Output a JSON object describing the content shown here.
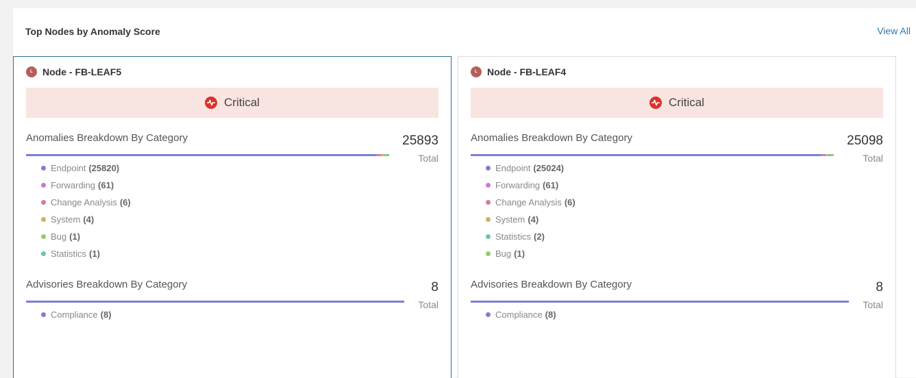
{
  "panel": {
    "title": "Top Nodes by Anomaly Score",
    "view_all": "View All"
  },
  "colors": {
    "endpoint": "#7b7fd4",
    "forwarding": "#c77ad4",
    "change_analysis": "#d67c96",
    "system": "#d0b060",
    "bug": "#8ccf6a",
    "statistics": "#6cc7a8",
    "compliance": "#7b7fd4",
    "critical": "#d9342b",
    "critical_bg": "#f8e4e0",
    "node_badge": "#b65f5a"
  },
  "cards": [
    {
      "node_badge": "L",
      "node_title": "Node -  FB-LEAF5",
      "severity": "Critical",
      "anomalies": {
        "title": "Anomalies Breakdown By Category",
        "total": "25893",
        "total_label": "Total",
        "items": [
          {
            "label": "Endpoint",
            "count": "(25820)",
            "color_key": "endpoint",
            "value": 25820
          },
          {
            "label": "Forwarding",
            "count": "(61)",
            "color_key": "forwarding",
            "value": 61
          },
          {
            "label": "Change Analysis",
            "count": "(6)",
            "color_key": "change_analysis",
            "value": 6
          },
          {
            "label": "System",
            "count": "(4)",
            "color_key": "system",
            "value": 4
          },
          {
            "label": "Bug",
            "count": "(1)",
            "color_key": "bug",
            "value": 1
          },
          {
            "label": "Statistics",
            "count": "(1)",
            "color_key": "statistics",
            "value": 1
          }
        ]
      },
      "advisories": {
        "title": "Advisories Breakdown By Category",
        "total": "8",
        "total_label": "Total",
        "items": [
          {
            "label": "Compliance",
            "count": "(8)",
            "color_key": "compliance",
            "value": 8
          }
        ]
      }
    },
    {
      "node_badge": "L",
      "node_title": "Node -  FB-LEAF4",
      "severity": "Critical",
      "anomalies": {
        "title": "Anomalies Breakdown By Category",
        "total": "25098",
        "total_label": "Total",
        "items": [
          {
            "label": "Endpoint",
            "count": "(25024)",
            "color_key": "endpoint",
            "value": 25024
          },
          {
            "label": "Forwarding",
            "count": "(61)",
            "color_key": "forwarding",
            "value": 61
          },
          {
            "label": "Change Analysis",
            "count": "(6)",
            "color_key": "change_analysis",
            "value": 6
          },
          {
            "label": "System",
            "count": "(4)",
            "color_key": "system",
            "value": 4
          },
          {
            "label": "Statistics",
            "count": "(2)",
            "color_key": "statistics",
            "value": 2
          },
          {
            "label": "Bug",
            "count": "(1)",
            "color_key": "bug",
            "value": 1
          }
        ]
      },
      "advisories": {
        "title": "Advisories Breakdown By Category",
        "total": "8",
        "total_label": "Total",
        "items": [
          {
            "label": "Compliance",
            "count": "(8)",
            "color_key": "compliance",
            "value": 8
          }
        ]
      }
    }
  ]
}
